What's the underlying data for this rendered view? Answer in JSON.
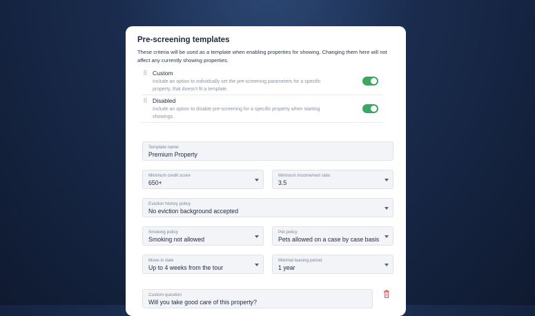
{
  "panel": {
    "title": "Pre-screening templates",
    "description": "These criteria will be used as a template when enabling properties for showing. Changing them here will not affect any currently showing properties."
  },
  "templates": [
    {
      "name": "Custom",
      "description": "Include an option to individually set the pre-screening parameters for a specific property, that doesn't fit a template.",
      "enabled": true
    },
    {
      "name": "Disabled",
      "description": "Include an option to disable pre-screening for a specific property when starting showings.",
      "enabled": true
    }
  ],
  "form": {
    "template_name": {
      "label": "Template name",
      "value": "Premium Property"
    },
    "min_credit": {
      "label": "Minimum credit score",
      "value": "650+"
    },
    "income_ratio": {
      "label": "Minimum income/rent ratio",
      "value": "3.5"
    },
    "eviction": {
      "label": "Eviction history policy",
      "value": "No eviction background accepted"
    },
    "smoking": {
      "label": "Smoking policy",
      "value": "Smoking not allowed"
    },
    "pet": {
      "label": "Pet policy",
      "value": "Pets allowed on a case by case basis"
    },
    "move_in": {
      "label": "Move in date",
      "value": "Up to 4 weeks from the tour"
    },
    "lease": {
      "label": "Minimal leasing period",
      "value": "1 year"
    },
    "custom_question": {
      "label": "Custom question",
      "value": "Will you take good care of this property?"
    }
  },
  "colors": {
    "toggle_on": "#3aa860",
    "delete": "#e05a5a"
  },
  "icons": {
    "drag": "drag-handle-icon",
    "dropdown": "chevron-down-icon",
    "delete": "trash-icon"
  }
}
